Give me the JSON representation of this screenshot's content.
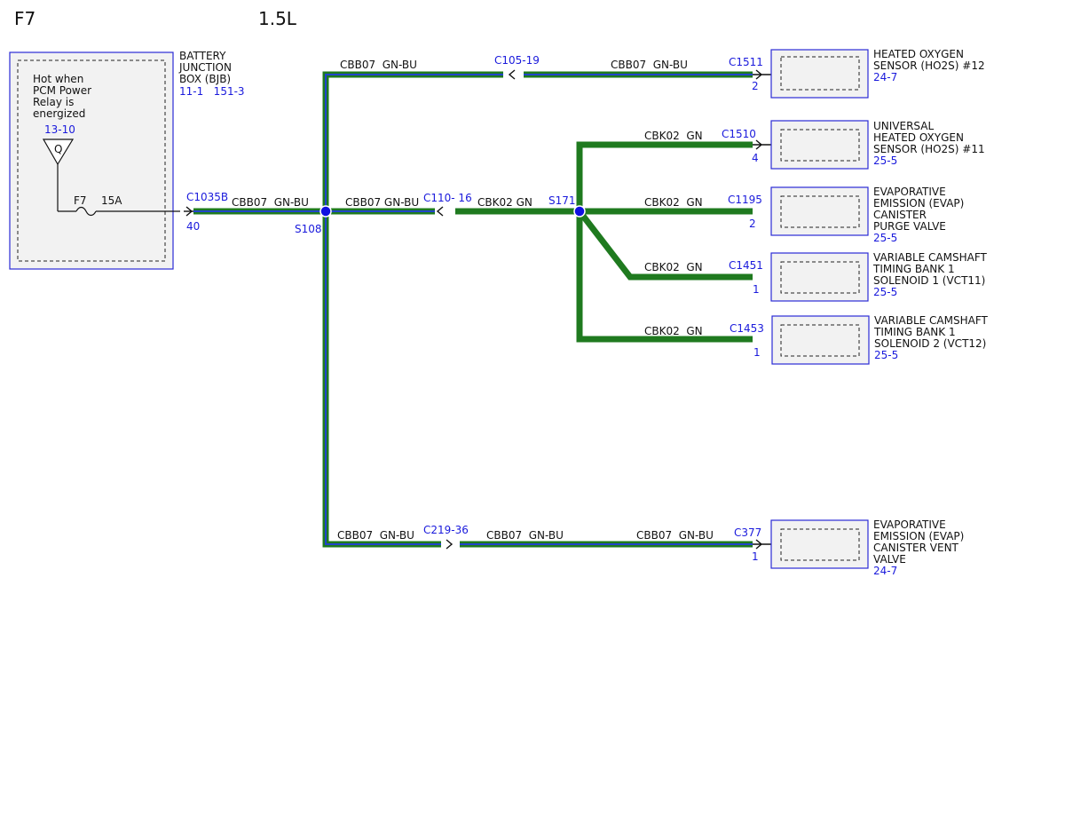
{
  "header": {
    "fuse_id": "F7",
    "engine": "1.5L"
  },
  "colors": {
    "wire_gn": "#1f7a1f",
    "wire_bu": "#2244cc",
    "ref_blue": "#1a1adc",
    "box_border": "#2b2bd6"
  },
  "bjb": {
    "note_lines": [
      "Hot when",
      "PCM Power",
      "Relay is",
      "energized"
    ],
    "ref_top": "13-10",
    "symbol": "Q",
    "fuse_label": "F7",
    "fuse_rating": "15A",
    "name_lines": [
      "BATTERY",
      "JUNCTION",
      "BOX (BJB)"
    ],
    "refs": "11-1   151-3"
  },
  "connectors": {
    "c1035b": "C1035B",
    "c1035b_pin": "40",
    "c110": "C110- 16",
    "c105": "C105-19",
    "c219": "C219-36",
    "c1511": "C1511",
    "c1511_pin": "2",
    "c1510": "C1510",
    "c1510_pin": "4",
    "c1195": "C1195",
    "c1195_pin": "2",
    "c1451": "C1451",
    "c1451_pin": "1",
    "c1453": "C1453",
    "c1453_pin": "1",
    "c377": "C377",
    "c377_pin": "1"
  },
  "splices": {
    "s108": "S108",
    "s171": "S171"
  },
  "wires": {
    "cbb07_spaced": "CBB07  GN-BU",
    "cbb07_tight": "CBB07 GN-BU",
    "cbk02_spaced": "CBK02  GN",
    "cbk02_tight": "CBK02 GN"
  },
  "components": {
    "ho2s12": {
      "lines": [
        "HEATED OXYGEN",
        "SENSOR (HO2S) #12"
      ],
      "ref": "24-7"
    },
    "uho2s11": {
      "lines": [
        "UNIVERSAL",
        "HEATED OXYGEN",
        "SENSOR (HO2S) #11"
      ],
      "ref": "25-5"
    },
    "evap_purge": {
      "lines": [
        "EVAPORATIVE",
        "EMISSION (EVAP)",
        "CANISTER",
        "PURGE VALVE"
      ],
      "ref": "25-5"
    },
    "vct11": {
      "lines": [
        "VARIABLE CAMSHAFT",
        "TIMING BANK 1",
        "SOLENOID 1 (VCT11)"
      ],
      "ref": "25-5"
    },
    "vct12": {
      "lines": [
        "VARIABLE CAMSHAFT",
        "TIMING BANK 1",
        "SOLENOID 2 (VCT12)"
      ],
      "ref": "25-5"
    },
    "evap_vent": {
      "lines": [
        "EVAPORATIVE",
        "EMISSION (EVAP)",
        "CANISTER VENT",
        "VALVE"
      ],
      "ref": "24-7"
    }
  }
}
